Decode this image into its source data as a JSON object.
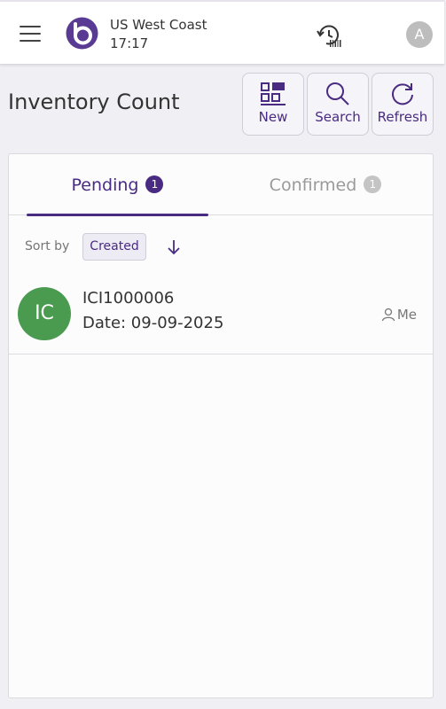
{
  "header": {
    "store": "US West Coast",
    "time": "17:17",
    "user_initial": "A"
  },
  "page": {
    "title": "Inventory Count"
  },
  "actions": {
    "new_label": "New",
    "search_label": "Search",
    "refresh_label": "Refresh"
  },
  "tabs": [
    {
      "label": "Pending",
      "count": "1",
      "active": true
    },
    {
      "label": "Confirmed",
      "count": "1",
      "active": false
    }
  ],
  "sort": {
    "label": "Sort by",
    "value": "Created",
    "direction": "descending"
  },
  "items": [
    {
      "initials": "IC",
      "id": "ICI1000006",
      "date": "Date: 09-09-2025",
      "owner": "Me"
    }
  ],
  "colors": {
    "accent": "#4a2b82",
    "avatar_green": "#4a9a4f"
  }
}
